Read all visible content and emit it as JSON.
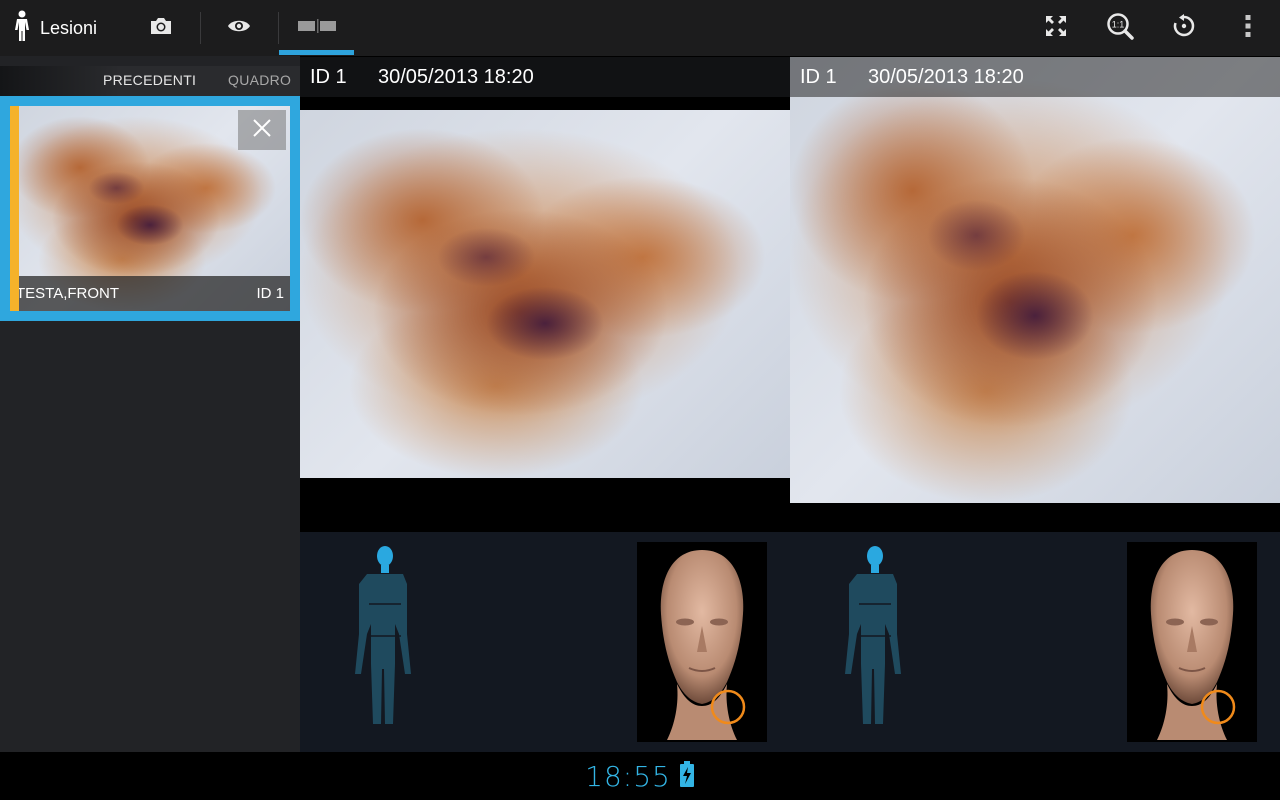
{
  "actionbar": {
    "title": "Lesioni",
    "icons": [
      "person-icon",
      "camera-icon",
      "eye-icon",
      "split-view-icon",
      "fullscreen-icon",
      "zoom-1to1-icon",
      "reset-icon",
      "overflow-menu-icon"
    ]
  },
  "sidebar": {
    "tabs": [
      {
        "label": "PRECEDENTI",
        "selected": true
      },
      {
        "label": "QUADRO",
        "selected": false
      }
    ],
    "thumbnail": {
      "location": "TESTA,FRONT",
      "id": "ID 1"
    }
  },
  "panes": [
    {
      "id": "ID 1",
      "datetime": "30/05/2013 18:20"
    },
    {
      "id": "ID 1",
      "datetime": "30/05/2013 18:20"
    }
  ],
  "colors": {
    "accent": "#33b5e5",
    "selection_border": "#2fa7de",
    "thumb_marker": "#f5b22a",
    "lesion_marker": "#f08a1a"
  },
  "status": {
    "time": "18:55"
  }
}
